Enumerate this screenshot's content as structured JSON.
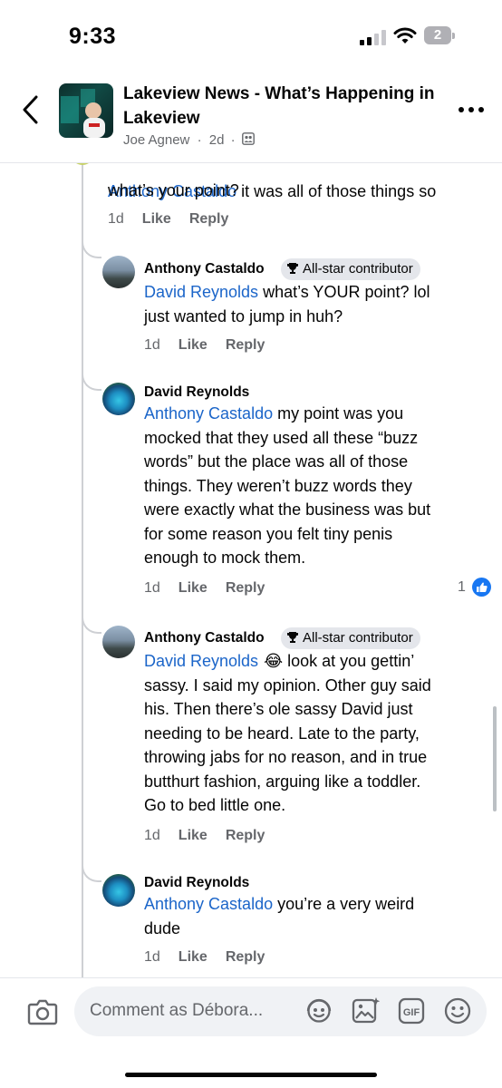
{
  "status_bar": {
    "time": "9:33",
    "battery": "2"
  },
  "header": {
    "title": "Lakeview News - What’s Happening in Lakeview",
    "author": "Joe Agnew",
    "age": "2d",
    "separator": "·"
  },
  "top_comment_tail": {
    "mention": "Anthony Castaldo",
    "text_line1": " it was all of those things so",
    "text_line2": "what’s your point?",
    "age": "1d",
    "like": "Like",
    "reply": "Reply"
  },
  "replies": [
    {
      "author": "Anthony Castaldo",
      "badge": "All-star contributor",
      "mention": "David Reynolds",
      "text": " what’s YOUR point? lol\njust wanted to jump in huh?",
      "age": "1d",
      "like": "Like",
      "reply": "Reply"
    },
    {
      "author": "David Reynolds",
      "mention": "Anthony Castaldo",
      "text": " my point was you\nmocked that they used all these “buzz\nwords” but the place was all of those\nthings.  They weren’t buzz words they\nwere exactly what the business was but\nfor some reason you felt tiny penis\nenough to mock them.",
      "age": "1d",
      "like": "Like",
      "reply": "Reply",
      "reaction_count": "1"
    },
    {
      "author": "Anthony Castaldo",
      "badge": "All-star contributor",
      "mention": "David Reynolds",
      "emoji": "😂",
      "text": " look at you gettin’\nsassy. I said my opinion. Other guy said\nhis. Then there’s ole sassy David just\nneeding to be heard. Late to the party,\nthrowing jabs for no reason, and in true\nbutthurt fashion, arguing like a toddler.\nGo to bed little one.",
      "age": "1d",
      "like": "Like",
      "reply": "Reply"
    },
    {
      "author": "David Reynolds",
      "mention": "Anthony Castaldo",
      "text": " you’re a very  weird\ndude",
      "age": "1d",
      "like": "Like",
      "reply": "Reply"
    }
  ],
  "composer": {
    "placeholder": "Comment as Débora..."
  },
  "colors": {
    "mention": "#1b65c9",
    "secondary_text": "#65676b",
    "like_blue": "#1877f2"
  }
}
